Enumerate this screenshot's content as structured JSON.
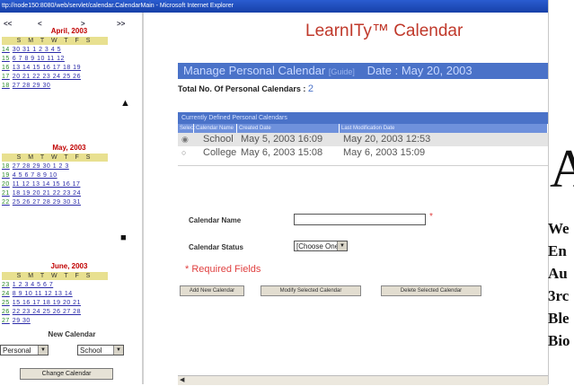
{
  "window": {
    "title": "ttp://node150:8080/web/servlet/calendar.CalendarMain - Microsoft Internet Explorer"
  },
  "left_pane": {
    "nav": [
      "<<",
      "<",
      ">",
      ">>"
    ],
    "months": [
      {
        "title": "April, 2003",
        "weekdays": "S M T W T F S",
        "weeks": [
          {
            "wk": "14",
            "days": "30 31 1 2 3 4 5"
          },
          {
            "wk": "15",
            "days": "6 7 8 9 10 11 12"
          },
          {
            "wk": "16",
            "days": "13 14 15 16 17 18 19"
          },
          {
            "wk": "17",
            "days": "20 21 22 23 24 25 26"
          },
          {
            "wk": "18",
            "days": "27 28 29 30"
          }
        ]
      },
      {
        "title": "May, 2003",
        "weekdays": "S M T W T F S",
        "weeks": [
          {
            "wk": "18",
            "days": "27 28 29 30 1 2 3"
          },
          {
            "wk": "19",
            "days": "4 5 6 7 8 9 10"
          },
          {
            "wk": "20",
            "days": "11 12 13 14 15 16 17"
          },
          {
            "wk": "21",
            "days": "18 19 20 21 22 23 24"
          },
          {
            "wk": "22",
            "days": "25 26 27 28 29 30 31"
          }
        ]
      },
      {
        "title": "June, 2003",
        "weekdays": "S M T W T F S",
        "weeks": [
          {
            "wk": "23",
            "days": "1 2 3 4 5 6 7"
          },
          {
            "wk": "24",
            "days": "8 9 10 11 12 13 14"
          },
          {
            "wk": "25",
            "days": "15 16 17 18 19 20 21"
          },
          {
            "wk": "26",
            "days": "22 23 24 25 26 27 28"
          },
          {
            "wk": "27",
            "days": "29 30"
          }
        ]
      }
    ],
    "new_calendar_label": "New Calendar",
    "type_select": "Personal",
    "calendar_select": "School",
    "change_button": "Change Calendar"
  },
  "main": {
    "app_title": "LearnITy™ Calendar",
    "section_title": "Manage Personal Calendar",
    "section_hint": "[Guide]",
    "date_label": "Date : May 20, 2003",
    "total_label": "Total No. Of Personal Calendars :",
    "total_value": "2",
    "table_caption": "Currently Defined Personal Calendars",
    "table_headers": [
      "Select",
      "Calendar Name",
      "Created Date",
      "Last Modification Date"
    ],
    "rows": [
      {
        "radio": "◉",
        "name": "School",
        "created": "May 5, 2003 16:09",
        "modified": "May 20, 2003 12:53"
      },
      {
        "radio": "○",
        "name": "College",
        "created": "May 6, 2003 15:08",
        "modified": "May 6, 2003 15:09"
      }
    ],
    "calendar_name_label": "Calendar Name",
    "calendar_status_label": "Calendar Status",
    "status_value": "[Choose One]",
    "required_star": "*",
    "required_text": "* Required Fields",
    "buttons": [
      "Add New Calendar",
      "Modify Selected Calendar",
      "Delete Selected Calendar"
    ]
  },
  "background_document": {
    "big_letter": "A",
    "lines": [
      "We",
      "En",
      "Au",
      "3rc",
      "Ble",
      "Bio"
    ]
  }
}
